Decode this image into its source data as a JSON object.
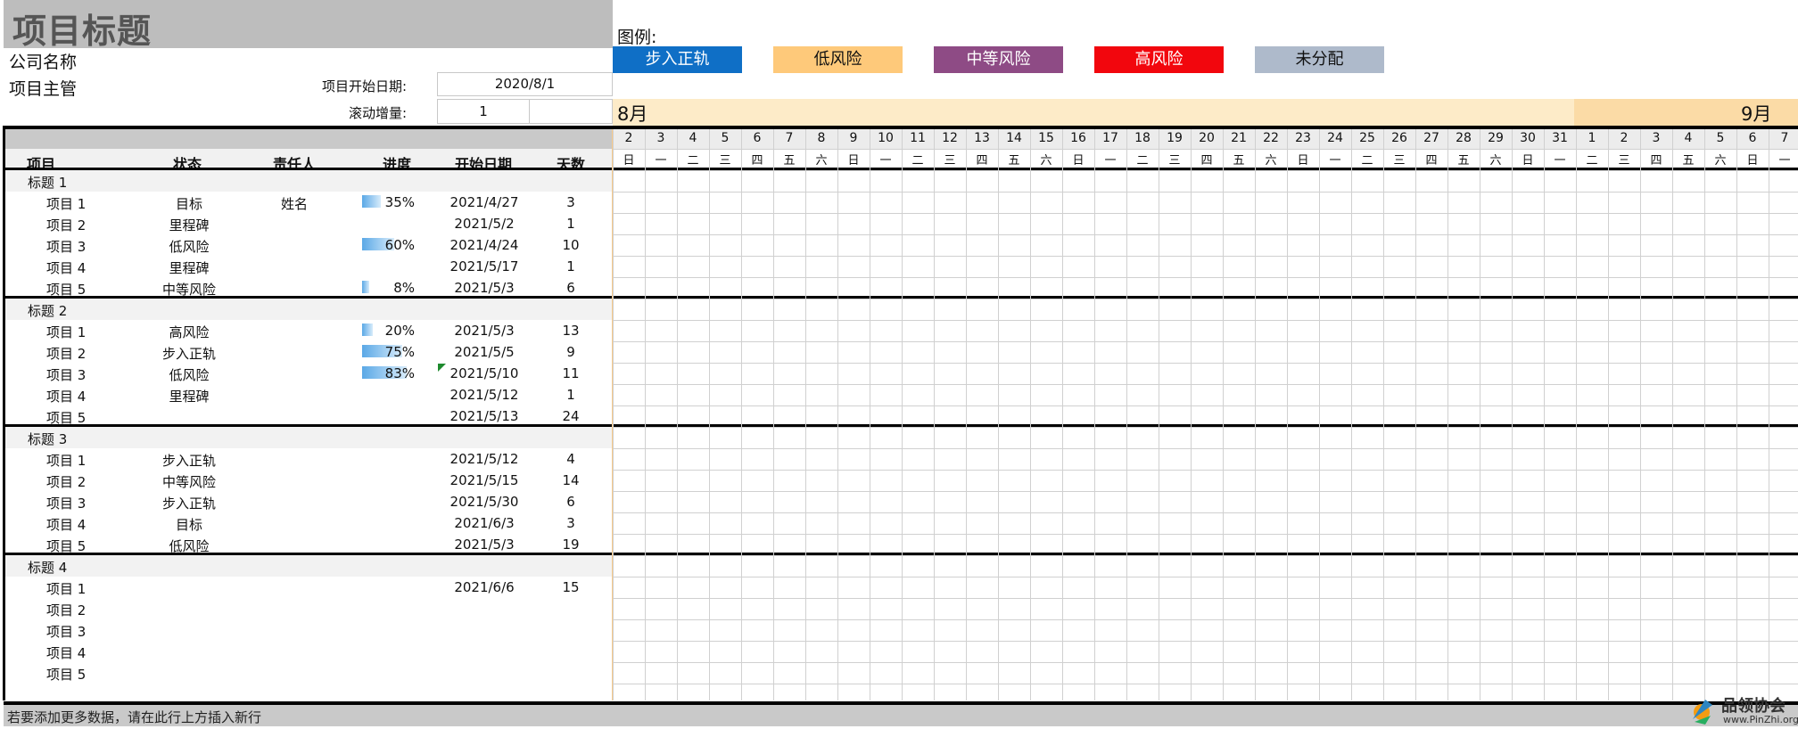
{
  "header": {
    "title": "项目标题",
    "company": "公司名称",
    "manager": "项目主管",
    "start_label": "项目开始日期:",
    "start_value": "2020/8/1",
    "scroll_label": "滚动增量:",
    "scroll_value": "1"
  },
  "legend": {
    "label": "图例:",
    "items": [
      {
        "label": "步入正轨",
        "bg": "#0f6fc6",
        "fg": "#ffffff"
      },
      {
        "label": "低风险",
        "bg": "#fec97a",
        "fg": "#111111"
      },
      {
        "label": "中等风险",
        "bg": "#8e4b85",
        "fg": "#ffffff"
      },
      {
        "label": "高风险",
        "bg": "#f2060d",
        "fg": "#ffffff"
      },
      {
        "label": "未分配",
        "bg": "#aebacb",
        "fg": "#111111"
      }
    ]
  },
  "months": {
    "aug": "8月",
    "sep": "9月"
  },
  "columns": {
    "item": "项目",
    "status": "状态",
    "owner": "责任人",
    "progress": "进度",
    "start": "开始日期",
    "days": "天数"
  },
  "sections": [
    {
      "title": "标题 1",
      "rows": [
        {
          "item": "项目 1",
          "status": "目标",
          "owner": "姓名",
          "progress": "35%",
          "pct": 35,
          "start": "2021/4/27",
          "days": "3"
        },
        {
          "item": "项目 2",
          "status": "里程碑",
          "owner": "",
          "progress": "",
          "pct": 0,
          "start": "2021/5/2",
          "days": "1"
        },
        {
          "item": "项目 3",
          "status": "低风险",
          "owner": "",
          "progress": "60%",
          "pct": 60,
          "start": "2021/4/24",
          "days": "10"
        },
        {
          "item": "项目 4",
          "status": "里程碑",
          "owner": "",
          "progress": "",
          "pct": 0,
          "start": "2021/5/17",
          "days": "1"
        },
        {
          "item": "项目 5",
          "status": "中等风险",
          "owner": "",
          "progress": "8%",
          "pct": 8,
          "start": "2021/5/3",
          "days": "6"
        }
      ]
    },
    {
      "title": "标题 2",
      "rows": [
        {
          "item": "项目 1",
          "status": "高风险",
          "owner": "",
          "progress": "20%",
          "pct": 20,
          "start": "2021/5/3",
          "days": "13"
        },
        {
          "item": "项目 2",
          "status": "步入正轨",
          "owner": "",
          "progress": "75%",
          "pct": 75,
          "start": "2021/5/5",
          "days": "9"
        },
        {
          "item": "项目 3",
          "status": "低风险",
          "owner": "",
          "progress": "83%",
          "pct": 83,
          "start": "2021/5/10",
          "days": "11"
        },
        {
          "item": "项目 4",
          "status": "里程碑",
          "owner": "",
          "progress": "",
          "pct": 0,
          "start": "2021/5/12",
          "days": "1"
        },
        {
          "item": "项目 5",
          "status": "",
          "owner": "",
          "progress": "",
          "pct": 0,
          "start": "2021/5/13",
          "days": "24"
        }
      ]
    },
    {
      "title": "标题 3",
      "rows": [
        {
          "item": "项目 1",
          "status": "步入正轨",
          "owner": "",
          "progress": "",
          "pct": 0,
          "start": "2021/5/12",
          "days": "4"
        },
        {
          "item": "项目 2",
          "status": "中等风险",
          "owner": "",
          "progress": "",
          "pct": 0,
          "start": "2021/5/15",
          "days": "14"
        },
        {
          "item": "项目 3",
          "status": "步入正轨",
          "owner": "",
          "progress": "",
          "pct": 0,
          "start": "2021/5/30",
          "days": "6"
        },
        {
          "item": "项目 4",
          "status": "目标",
          "owner": "",
          "progress": "",
          "pct": 0,
          "start": "2021/6/3",
          "days": "3"
        },
        {
          "item": "项目 5",
          "status": "低风险",
          "owner": "",
          "progress": "",
          "pct": 0,
          "start": "2021/5/3",
          "days": "19"
        }
      ]
    },
    {
      "title": "标题 4",
      "rows": [
        {
          "item": "项目 1",
          "status": "",
          "owner": "",
          "progress": "",
          "pct": 0,
          "start": "2021/6/6",
          "days": "15"
        },
        {
          "item": "项目 2",
          "status": "",
          "owner": "",
          "progress": "",
          "pct": 0,
          "start": "",
          "days": ""
        },
        {
          "item": "项目 3",
          "status": "",
          "owner": "",
          "progress": "",
          "pct": 0,
          "start": "",
          "days": ""
        },
        {
          "item": "项目 4",
          "status": "",
          "owner": "",
          "progress": "",
          "pct": 0,
          "start": "",
          "days": ""
        },
        {
          "item": "项目 5",
          "status": "",
          "owner": "",
          "progress": "",
          "pct": 0,
          "start": "",
          "days": ""
        }
      ]
    }
  ],
  "timeline": {
    "days": [
      "2",
      "3",
      "4",
      "5",
      "6",
      "7",
      "8",
      "9",
      "10",
      "11",
      "12",
      "13",
      "14",
      "15",
      "16",
      "17",
      "18",
      "19",
      "20",
      "21",
      "22",
      "23",
      "24",
      "25",
      "26",
      "27",
      "28",
      "29",
      "30",
      "31",
      "1",
      "2",
      "3",
      "4",
      "5",
      "6",
      "7"
    ],
    "weekdays": [
      "日",
      "一",
      "二",
      "三",
      "四",
      "五",
      "六",
      "日",
      "一",
      "二",
      "三",
      "四",
      "五",
      "六",
      "日",
      "一",
      "二",
      "三",
      "四",
      "五",
      "六",
      "日",
      "一",
      "二",
      "三",
      "四",
      "五",
      "六",
      "日",
      "一",
      "二",
      "三",
      "四",
      "五",
      "六",
      "日",
      "一"
    ]
  },
  "footer": {
    "text": "若要添加更多数据，请在此行上方插入新行"
  },
  "logo": {
    "name": "品领协会",
    "url": "www.PinZhi.org"
  }
}
